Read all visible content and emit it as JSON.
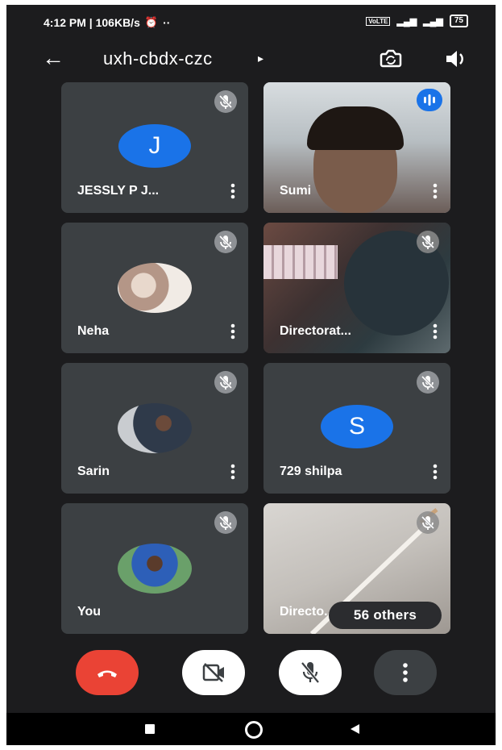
{
  "status_bar": {
    "time_speed": "4:12 PM | 106KB/s",
    "dots": "··",
    "battery": "75"
  },
  "meeting": {
    "code": "uxh-cbdx-czc",
    "caret": "▸"
  },
  "participants": [
    {
      "name": "JESSLY P J...",
      "avatar_letter": "J",
      "avatar_color": "#1a73e8"
    },
    {
      "name": "Sumi"
    },
    {
      "name": "Neha"
    },
    {
      "name": "Directorat..."
    },
    {
      "name": "Sarin"
    },
    {
      "name": "729 shilpa",
      "avatar_letter": "S",
      "avatar_color": "#1a73e8"
    },
    {
      "name": "You"
    },
    {
      "name": "Directo..."
    }
  ],
  "others_pill": "56 others",
  "colors": {
    "end_call": "#ea4335",
    "accent": "#1a73e8",
    "tile_bg": "#3c4043",
    "bg": "#1c1c1e"
  }
}
